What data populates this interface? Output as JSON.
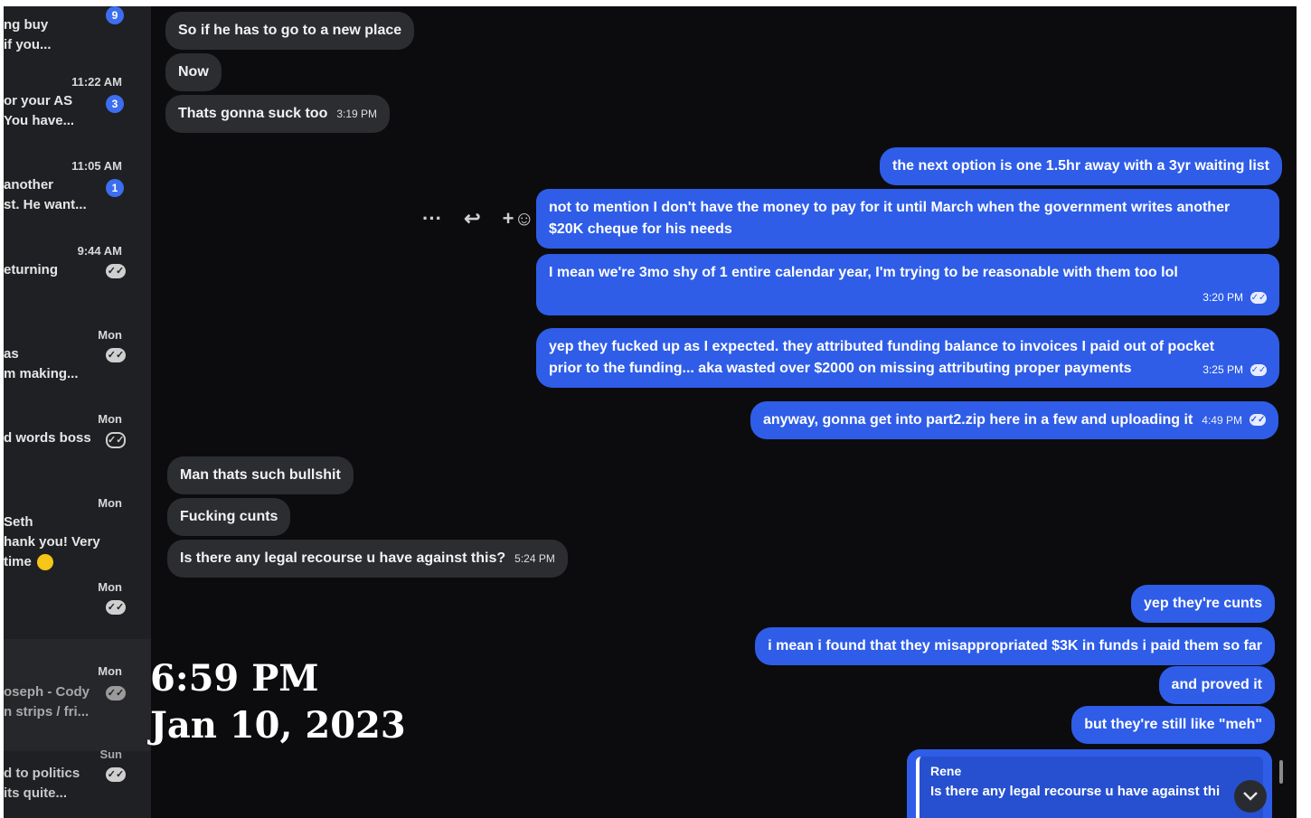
{
  "sidebar": {
    "conversations": [
      {
        "time": "",
        "line1": "ng buy",
        "line2": "if you...",
        "badge": "9",
        "read": ""
      },
      {
        "time": "11:22 AM",
        "line1": "or your AS",
        "line2": "You have...",
        "badge": "3",
        "read": ""
      },
      {
        "time": "11:05 AM",
        "line1": "another",
        "line2": "st. He want...",
        "badge": "1",
        "read": ""
      },
      {
        "time": "9:44 AM",
        "line1": "eturning",
        "line2": "",
        "badge": "",
        "read": "filled"
      },
      {
        "time": "Mon",
        "line1": "as",
        "line2": "m making...",
        "badge": "",
        "read": "filled"
      },
      {
        "time": "Mon",
        "line1": "d words boss",
        "line2": "",
        "badge": "",
        "read": "outline"
      },
      {
        "time": "Mon",
        "line1": "Seth",
        "line2": "hank you! Very",
        "line3": "time",
        "badge": "",
        "read": ""
      },
      {
        "time": "Mon",
        "line1": "",
        "line2": "",
        "badge": "",
        "read": "filled"
      },
      {
        "time": "Mon",
        "line1": "oseph - Cody",
        "line2": "n strips / fri...",
        "badge": "",
        "read": "filled"
      },
      {
        "time": "Sun",
        "line1": "d to politics",
        "line2": "its quite...",
        "badge": "",
        "read": "filled"
      }
    ]
  },
  "messages": {
    "m1": "So if he has to go to a new place",
    "m2": "Now",
    "m3": "Thats gonna suck too",
    "m3_time": "3:19 PM",
    "m4": "the next option is one 1.5hr away with a 3yr waiting list",
    "m5a": "not to mention I don't have the money to pay for it until March when the government writes another",
    "m5b": "$20K cheque for his needs",
    "m6": "I mean we're 3mo shy of 1 entire calendar year, I'm trying to be reasonable with them too lol",
    "m6_time": "3:20 PM",
    "m7a": "yep they fucked up as I expected. they attributed funding balance to invoices I paid out of pocket",
    "m7b": "prior to the funding... aka wasted over $2000 on missing attributing proper payments",
    "m7_time": "3:25 PM",
    "m8": "anyway, gonna get into part2.zip here in a few and uploading it",
    "m8_time": "4:49 PM",
    "m9": "Man thats such bullshit",
    "m10": "Fucking cunts",
    "m11": "Is there any legal recourse u have against this?",
    "m11_time": "5:24 PM",
    "m12": "yep they're cunts",
    "m13": "i mean i found that they misappropriated $3K in funds i paid them so far",
    "m14": "and proved it",
    "m15": "but they're still like \"meh\"",
    "reply_name": "Rene",
    "reply_text": "Is there any legal recourse u have against thi"
  },
  "hover_tools": {
    "more": "···",
    "reply": "↩",
    "react": "+☺"
  },
  "overlay": {
    "time": "6:59 PM",
    "date": "Jan 10, 2023"
  },
  "colors": {
    "outgoing": "#2f5de8",
    "incoming": "#2c2d31",
    "background": "#0c0c0e",
    "sidebar": "#1f2023"
  }
}
